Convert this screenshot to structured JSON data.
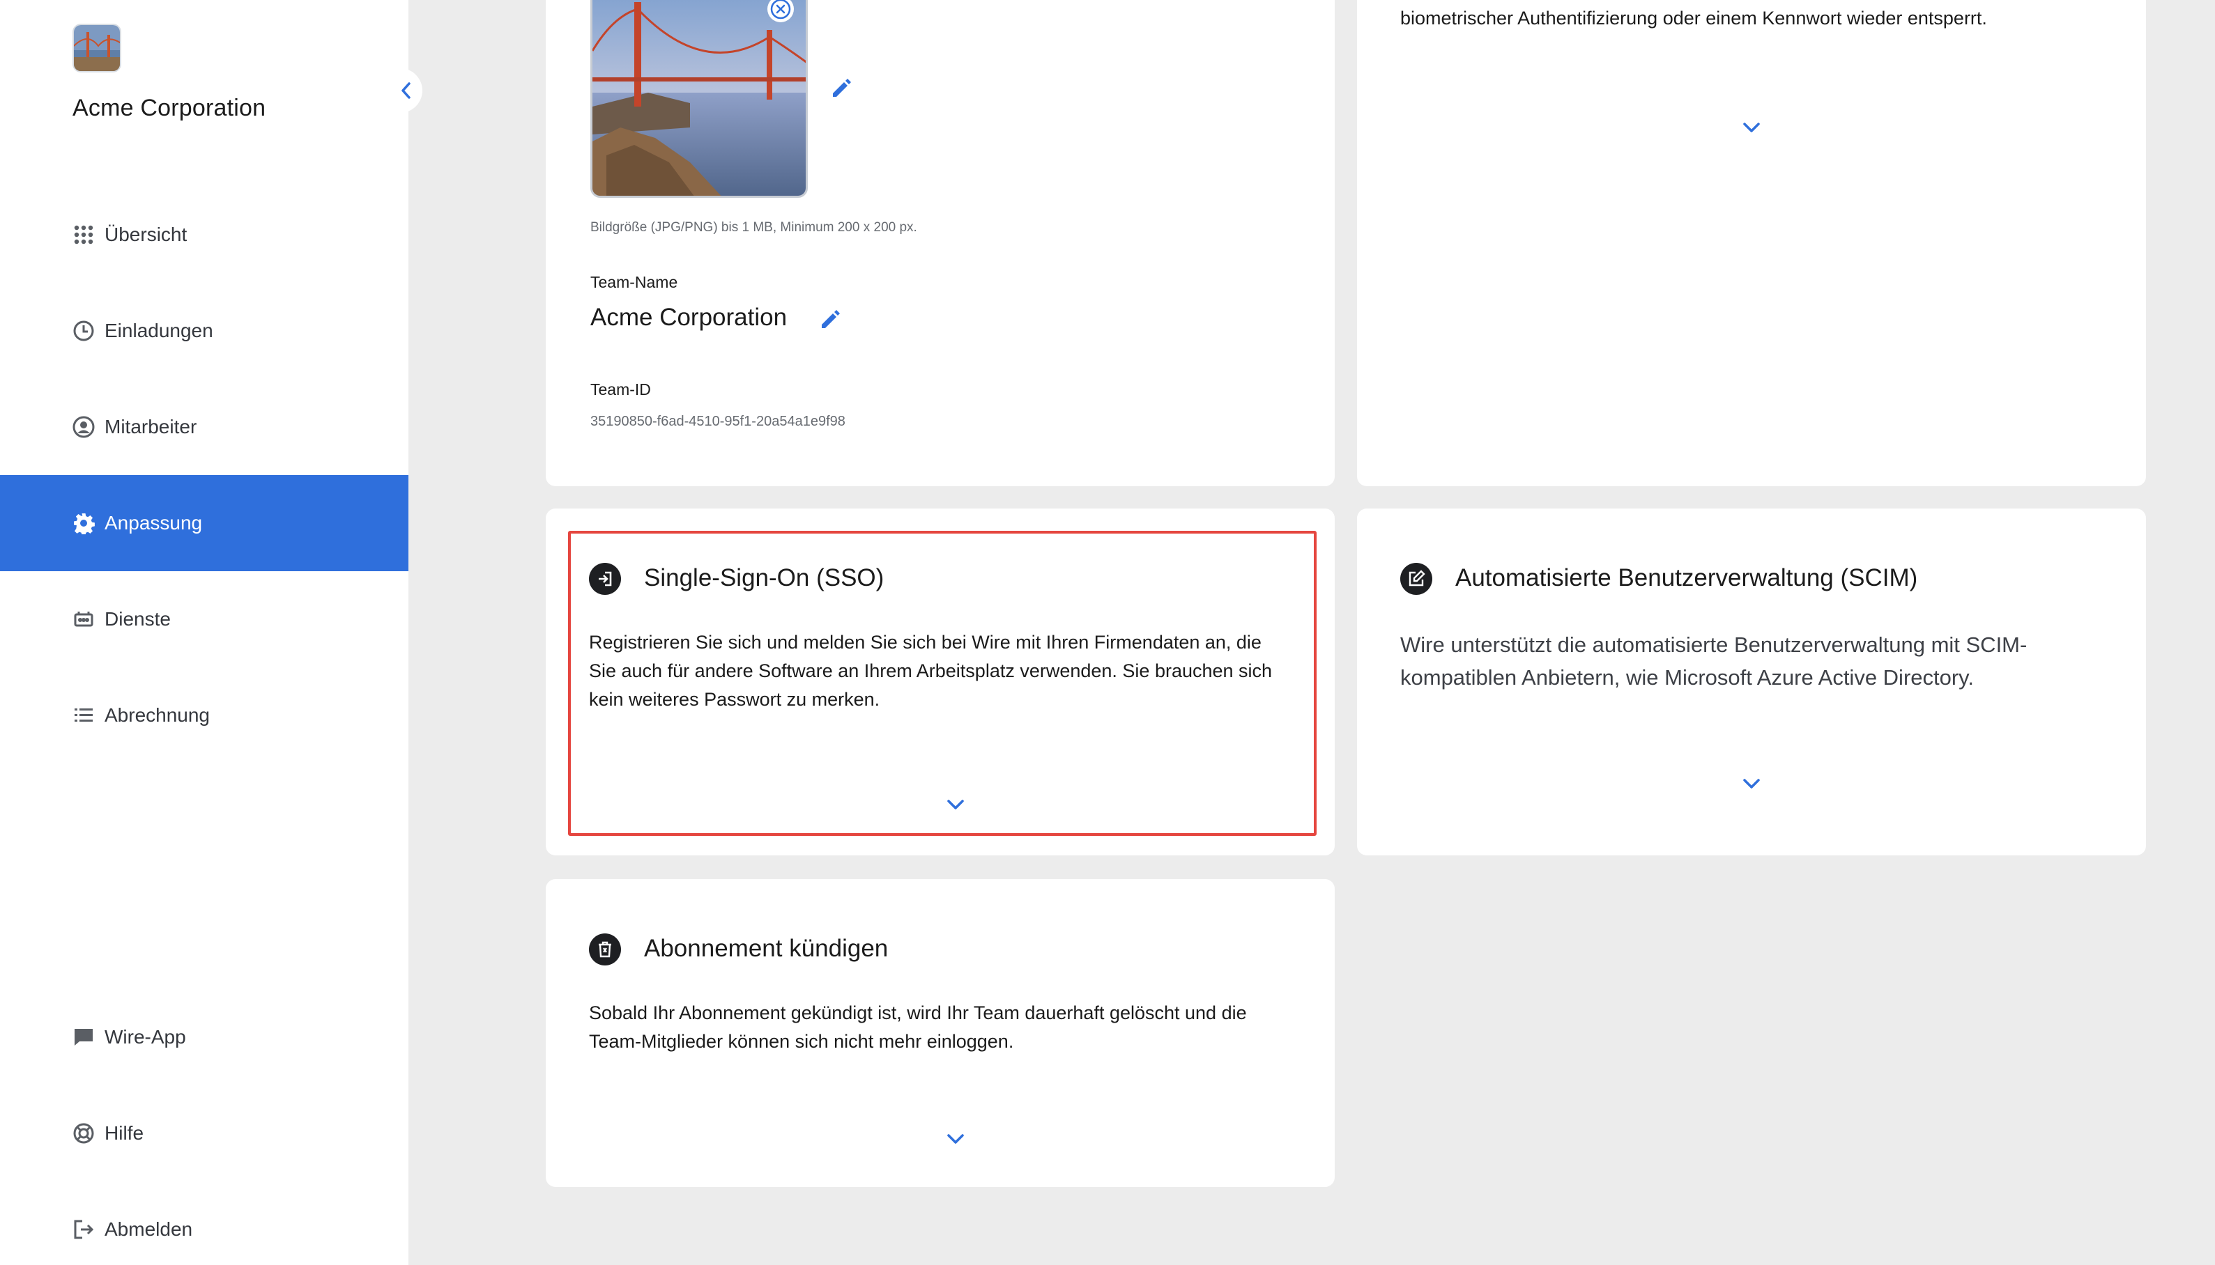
{
  "sidebar": {
    "team_name": "Acme Corporation",
    "nav": [
      {
        "label": "Übersicht",
        "icon": "grid-icon"
      },
      {
        "label": "Einladungen",
        "icon": "clock-icon"
      },
      {
        "label": "Mitarbeiter",
        "icon": "user-circle-icon"
      },
      {
        "label": "Anpassung",
        "icon": "gear-icon",
        "active": true
      },
      {
        "label": "Dienste",
        "icon": "services-icon"
      },
      {
        "label": "Abrechnung",
        "icon": "list-icon"
      }
    ],
    "bottom_nav": [
      {
        "label": "Wire-App",
        "icon": "chat-bubble-icon"
      },
      {
        "label": "Hilfe",
        "icon": "lifebuoy-icon"
      },
      {
        "label": "Abmelden",
        "icon": "logout-icon"
      }
    ]
  },
  "team_info": {
    "image_hint": "Bildgröße (JPG/PNG) bis 1 MB, Minimum 200 x 200 px.",
    "name_label": "Team-Name",
    "name_value": "Acme Corporation",
    "id_label": "Team-ID",
    "id_value": "35190850-f6ad-4510-95f1-20a54a1e9f98"
  },
  "app_lock": {
    "text": "biometrischer Authentifizierung oder einem Kennwort wieder entsperrt."
  },
  "sso": {
    "title": "Single-Sign-On (SSO)",
    "text": "Registrieren Sie sich und melden Sie sich bei Wire mit Ihren Firmendaten an, die Sie auch für andere Software an Ihrem Arbeitsplatz verwenden. Sie brauchen sich kein weiteres Passwort zu merken."
  },
  "scim": {
    "title": "Automatisierte Benutzerverwaltung (SCIM)",
    "text": "Wire unterstützt die automatisierte Benutzerverwaltung mit SCIM-kompatiblen Anbietern, wie Microsoft Azure Active Directory."
  },
  "cancel_subscription": {
    "title": "Abonnement kündigen",
    "text": "Sobald Ihr Abonnement gekündigt ist, wird Ihr Team dauerhaft gelöscht und die Team-Mitglieder können sich nicht mehr einloggen."
  },
  "colors": {
    "accent": "#2f6fdc",
    "highlight": "#e5463f",
    "background": "#ececec"
  }
}
